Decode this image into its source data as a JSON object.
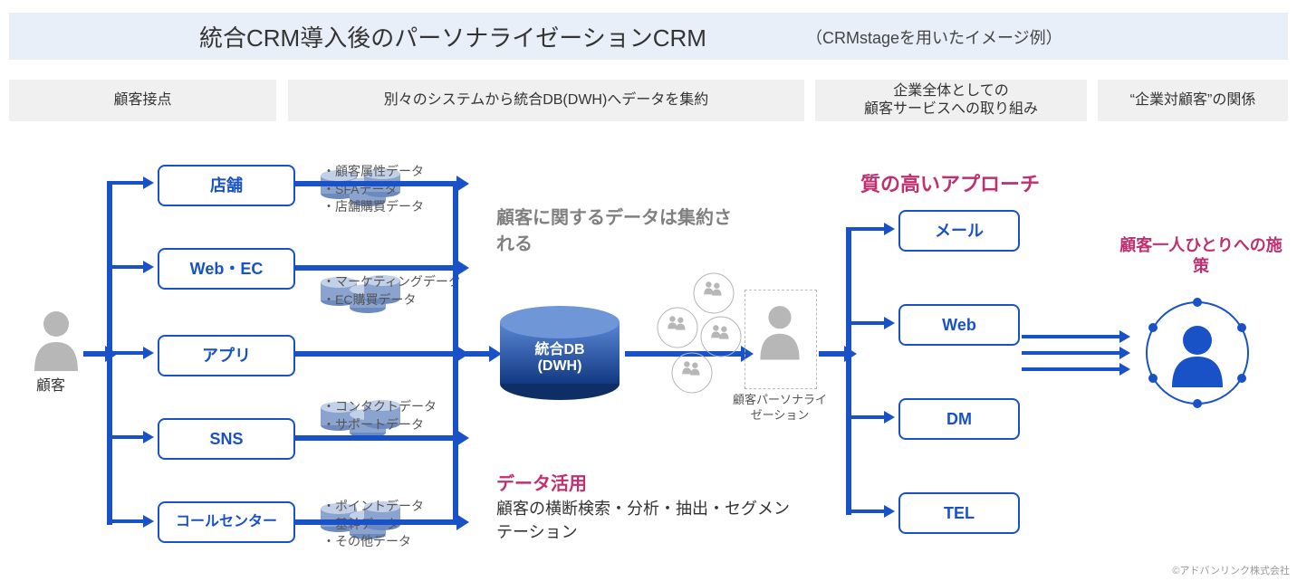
{
  "title": {
    "main": "統合CRM導入後のパーソナライゼーションCRM",
    "sub": "（CRMstageを用いたイメージ例）"
  },
  "columns": {
    "c1": "顧客接点",
    "c2": "別々のシステムから統合DB(DWH)へデータを集約",
    "c3": "企業全体としての\n顧客サービスへの取り組み",
    "c4": "“企業対顧客”の関係"
  },
  "customer_label": "顧客",
  "touchpoints": [
    "店舗",
    "Web・EC",
    "アプリ",
    "SNS",
    "コールセンター"
  ],
  "db_notes": [
    "・顧客属性データ\n・SFAデータ\n・店舗購買データ",
    "・マーケティングデータ\n・EC購買データ",
    "・コンタクトデータ\n・サポートデータ",
    "・ポイントデータ\n・基幹データ\n・その他データ"
  ],
  "central_db": {
    "line1": "統合DB",
    "line2": "(DWH)"
  },
  "aggregate_note": "顧客に関するデータは集約される",
  "persona_label": "顧客パーソナライゼーション",
  "usage": {
    "head": "データ活用",
    "body": "顧客の横断検索・分析・抽出・セグメンテーション"
  },
  "approach_head": "質の高いアプローチ",
  "approaches": [
    "メール",
    "Web",
    "DM",
    "TEL"
  ],
  "individual_note": "顧客一人ひとりへの施策",
  "copyright": "©アドバンリンク株式会社"
}
